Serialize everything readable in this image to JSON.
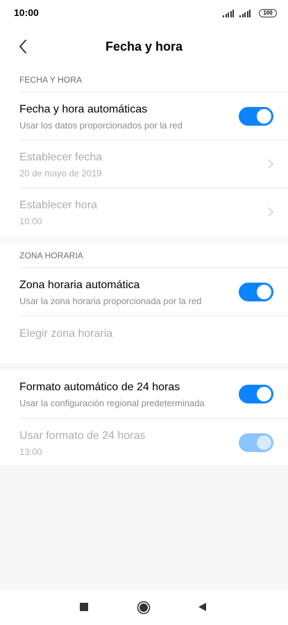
{
  "status": {
    "time": "10:00",
    "battery": "100",
    "icons": [
      "signal-icon",
      "signal-icon",
      "battery-icon"
    ]
  },
  "header": {
    "title": "Fecha y hora",
    "back_icon": "back-arrow-icon"
  },
  "sections": {
    "date_time": {
      "header": "FECHA Y HORA",
      "auto": {
        "title": "Fecha y hora automáticas",
        "subtitle": "Usar los datos proporcionados por la red",
        "enabled": true
      },
      "set_date": {
        "title": "Establecer fecha",
        "subtitle": "20 de mayo de 2019"
      },
      "set_time": {
        "title": "Establecer hora",
        "subtitle": "10:00"
      }
    },
    "timezone": {
      "header": "ZONA HORARIA",
      "auto": {
        "title": "Zona horaria automática",
        "subtitle": "Usar la zona horaria proporcionada por la red",
        "enabled": true
      },
      "choose": {
        "title": "Elegir zona horaria"
      }
    },
    "format": {
      "auto24": {
        "title": "Formato automático de 24 horas",
        "subtitle": "Usar la configuración regional predeterminada",
        "enabled": true
      },
      "use24": {
        "title": "Usar formato de 24 horas",
        "subtitle": "13:00",
        "enabled": true
      }
    }
  },
  "colors": {
    "accent": "#0d84ff",
    "accent_disabled": "#8cc4ff",
    "background": "#f7f7f7"
  },
  "navbar": {
    "icons": [
      "recents-square-icon",
      "home-circle-icon",
      "back-triangle-icon"
    ]
  }
}
